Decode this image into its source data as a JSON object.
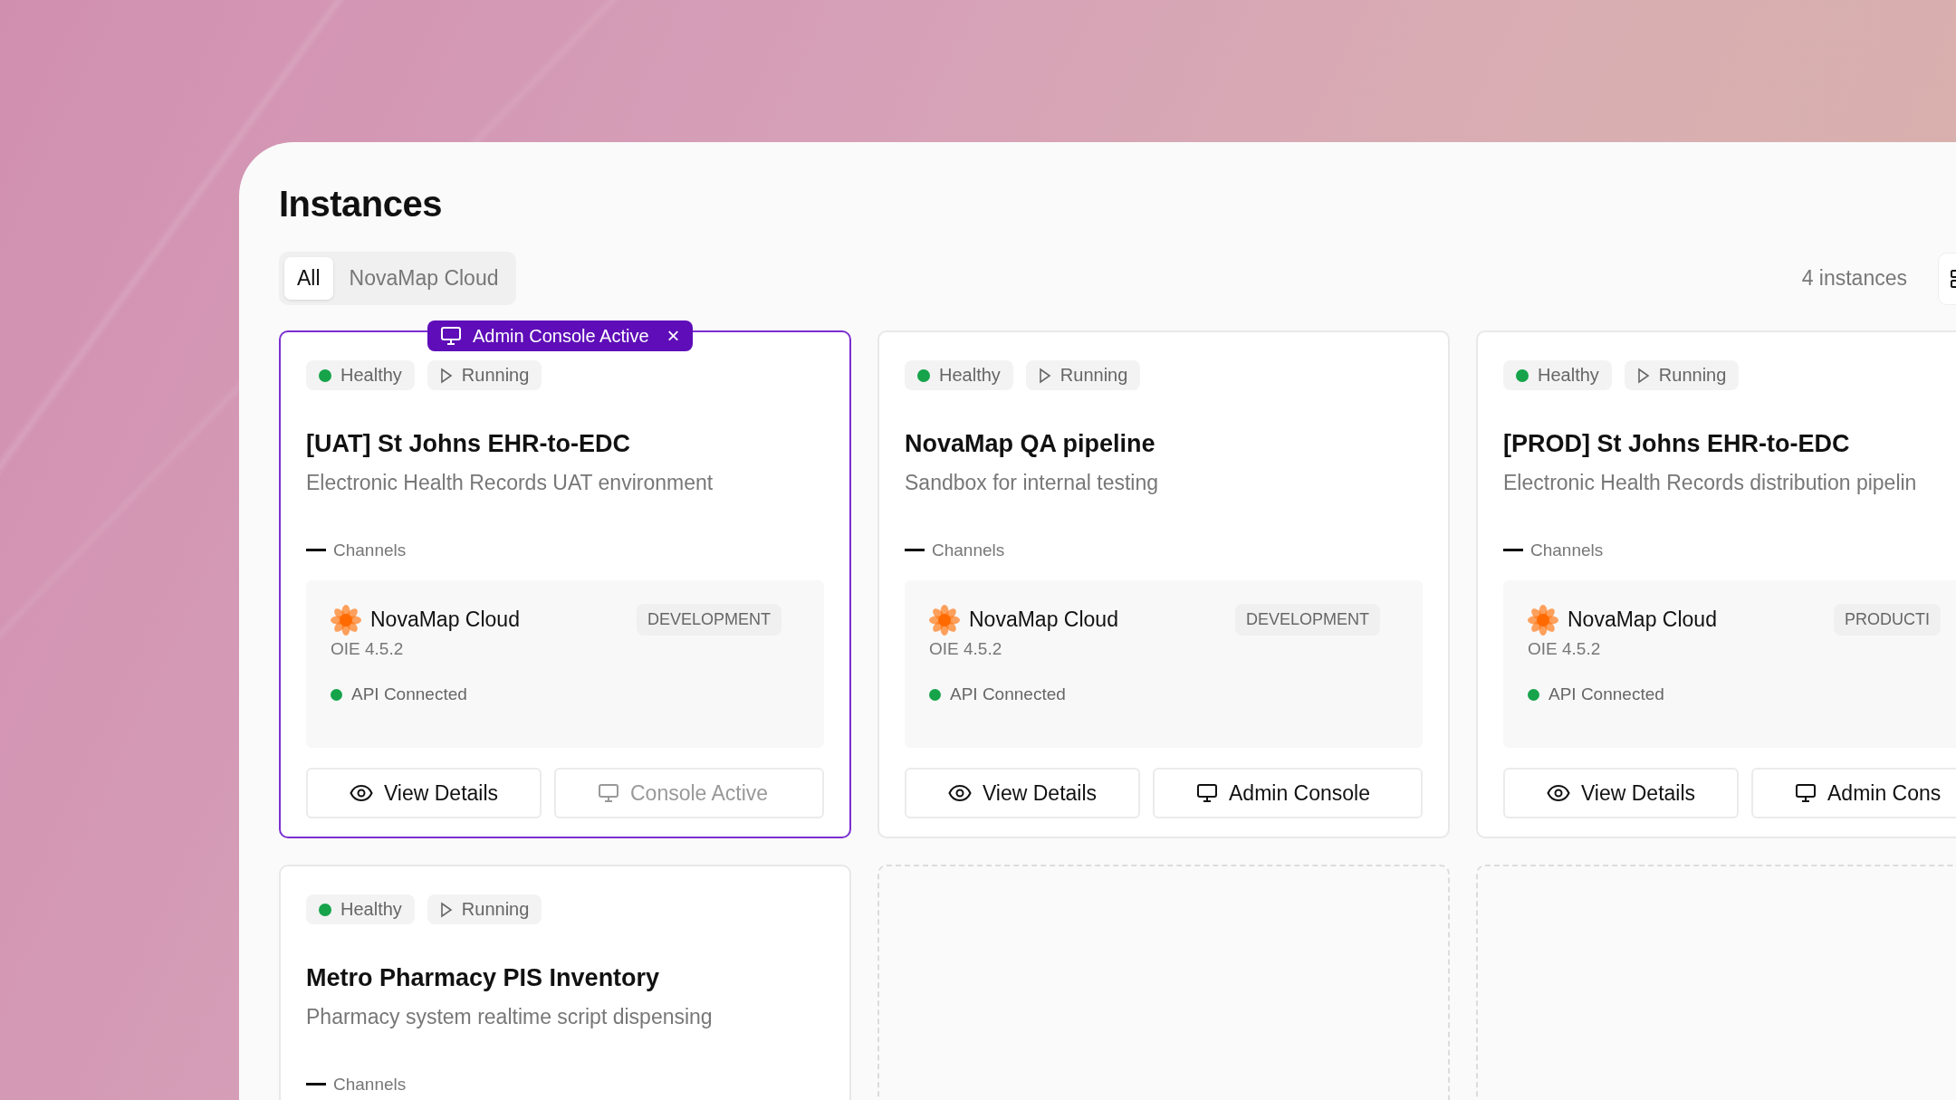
{
  "title": "Instances",
  "tabs": [
    {
      "label": "All",
      "selected": true
    },
    {
      "label": "NovaMap Cloud",
      "selected": false
    }
  ],
  "count": "4 instances",
  "cards": [
    {
      "kind": "instance",
      "selected": true,
      "banner": {
        "label": "Admin Console Active",
        "close": "×"
      },
      "health": "Healthy",
      "status": "Running",
      "name": "[UAT] St Johns EHR-to-EDC",
      "description": "Electronic Health Records UAT environment",
      "channels": "Channels",
      "provider": "NovaMap Cloud",
      "version": "OIE 4.5.2",
      "environment": "DEVELOPMENT",
      "api": "API Connected",
      "view_button": "View Details",
      "console_button": {
        "label": "Console Active",
        "disabled": true
      }
    },
    {
      "kind": "instance",
      "selected": false,
      "health": "Healthy",
      "status": "Running",
      "name": "NovaMap QA pipeline",
      "description": "Sandbox for internal testing",
      "channels": "Channels",
      "provider": "NovaMap Cloud",
      "version": "OIE 4.5.2",
      "environment": "DEVELOPMENT",
      "api": "API Connected",
      "view_button": "View Details",
      "console_button": {
        "label": "Admin Console",
        "disabled": false
      }
    },
    {
      "kind": "instance",
      "selected": false,
      "health": "Healthy",
      "status": "Running",
      "name": "[PROD] St Johns EHR-to-EDC",
      "description": "Electronic Health Records distribution pipelin",
      "channels": "Channels",
      "provider": "NovaMap Cloud",
      "version": "OIE 4.5.2",
      "environment": "PRODUCTI",
      "api": "API Connected",
      "view_button": "View Details",
      "console_button": {
        "label": "Admin Cons",
        "disabled": false
      }
    },
    {
      "kind": "instance",
      "selected": false,
      "health": "Healthy",
      "status": "Running",
      "name": "Metro Pharmacy PIS Inventory",
      "description": "Pharmacy system realtime script dispensing",
      "channels": "Channels"
    },
    {
      "kind": "placeholder"
    },
    {
      "kind": "placeholder"
    }
  ]
}
